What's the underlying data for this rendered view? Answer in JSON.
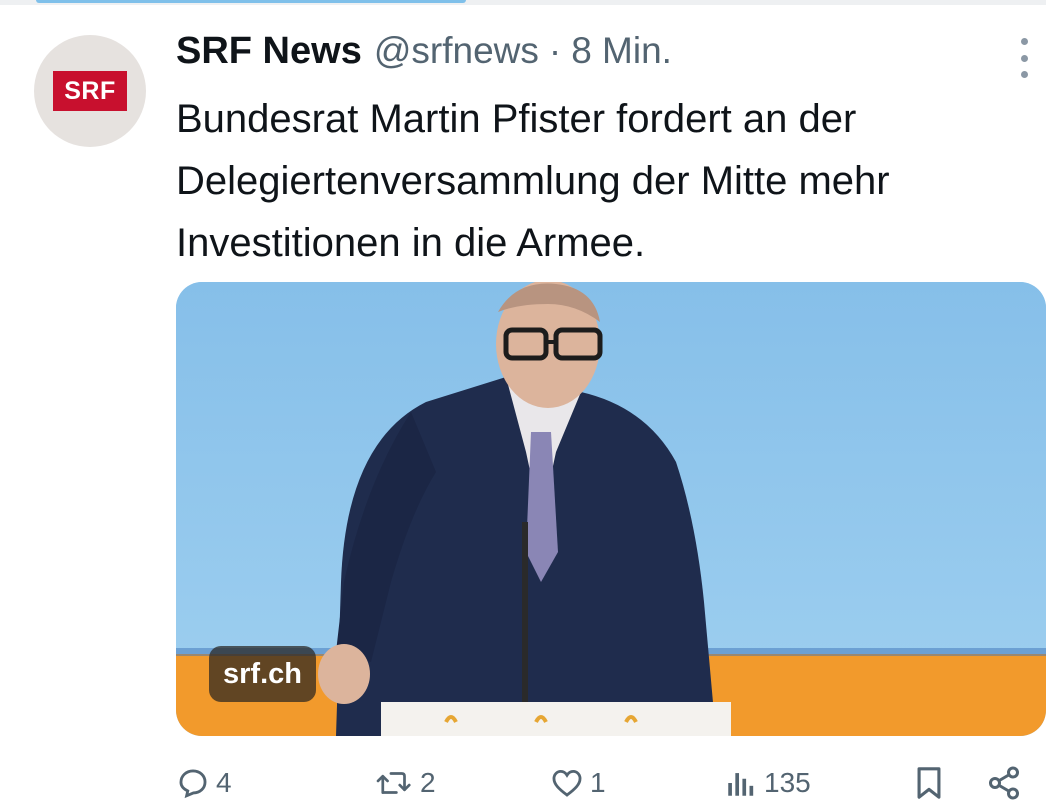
{
  "tweet": {
    "author_name": "SRF News",
    "handle": "@srfnews",
    "separator": "·",
    "time": "8 Min.",
    "text": "Bundesrat Martin Pfister fordert an der Delegiertenversammlung der Mitte mehr Investitionen in die Armee.",
    "avatar_logo": "SRF",
    "media": {
      "source_label": "srf.ch",
      "description": "photo"
    }
  },
  "actions": {
    "replies": "4",
    "reposts": "2",
    "likes": "1",
    "views": "135"
  },
  "icons": {
    "more": "more-vertical-icon",
    "reply": "reply-icon",
    "repost": "repost-icon",
    "like": "heart-icon",
    "views": "views-chart-icon",
    "bookmark": "bookmark-icon",
    "share": "share-icon"
  },
  "colors": {
    "text": "#0f1419",
    "secondary": "#536471",
    "srf_red": "#c8102e",
    "accent": "#7fc0ea"
  }
}
